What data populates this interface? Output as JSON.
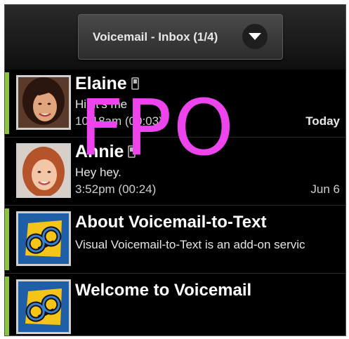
{
  "header": {
    "dropdown_title": "Voicemail - Inbox (1/4)"
  },
  "messages": [
    {
      "name": "Elaine",
      "preview": "Hi, it's me",
      "time": "10:18am (00:03)",
      "date": "Today",
      "date_bold": true,
      "has_phone_icon": true,
      "avatar": "woman-dark-hair-photo"
    },
    {
      "name": "Annie",
      "preview": "Hey hey.",
      "time": "3:52pm (00:24)",
      "date": "Jun 6",
      "date_bold": false,
      "has_phone_icon": true,
      "avatar": "woman-red-hair-photo"
    }
  ],
  "system_items": [
    {
      "title": "About Voicemail-to-Text",
      "subtitle": "Visual Voicemail-to-Text is an add-on servic",
      "icon": "voicemail-app-icon"
    },
    {
      "title": "Welcome to Voicemail",
      "subtitle": "",
      "icon": "voicemail-app-icon"
    }
  ],
  "overlay": {
    "text": "FPO"
  },
  "colors": {
    "accent_stripe": "#8cc63f",
    "overlay": "#ee44ee",
    "background": "#000000"
  }
}
